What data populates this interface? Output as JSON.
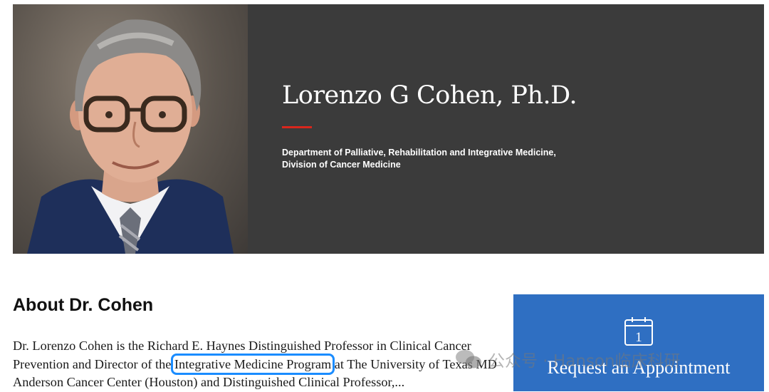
{
  "profile": {
    "name": "Lorenzo G Cohen, Ph.D.",
    "department_line1": "Department of Palliative, Rehabilitation and Integrative Medicine,",
    "department_line2": "Division of Cancer Medicine",
    "accent_color": "#d9261c"
  },
  "about": {
    "heading": "About Dr. Cohen",
    "bio_part1": "Dr. Lorenzo Cohen is the Richard E. Haynes Distinguished Professor in Clinical Cancer Prevention and Director of the ",
    "bio_highlight": "Integrative Medicine Program",
    "bio_part2": " at The University of Texas MD Anderson Cancer Center (Houston) and Distinguished Clinical Professor,..."
  },
  "appointment": {
    "label": "Request an Appointment",
    "calendar_day": "1",
    "icon": "calendar-icon",
    "background": "#2f6fc2"
  },
  "watermark": {
    "text": "公众号 · Hanson临床科研",
    "icon": "wechat-icon"
  }
}
